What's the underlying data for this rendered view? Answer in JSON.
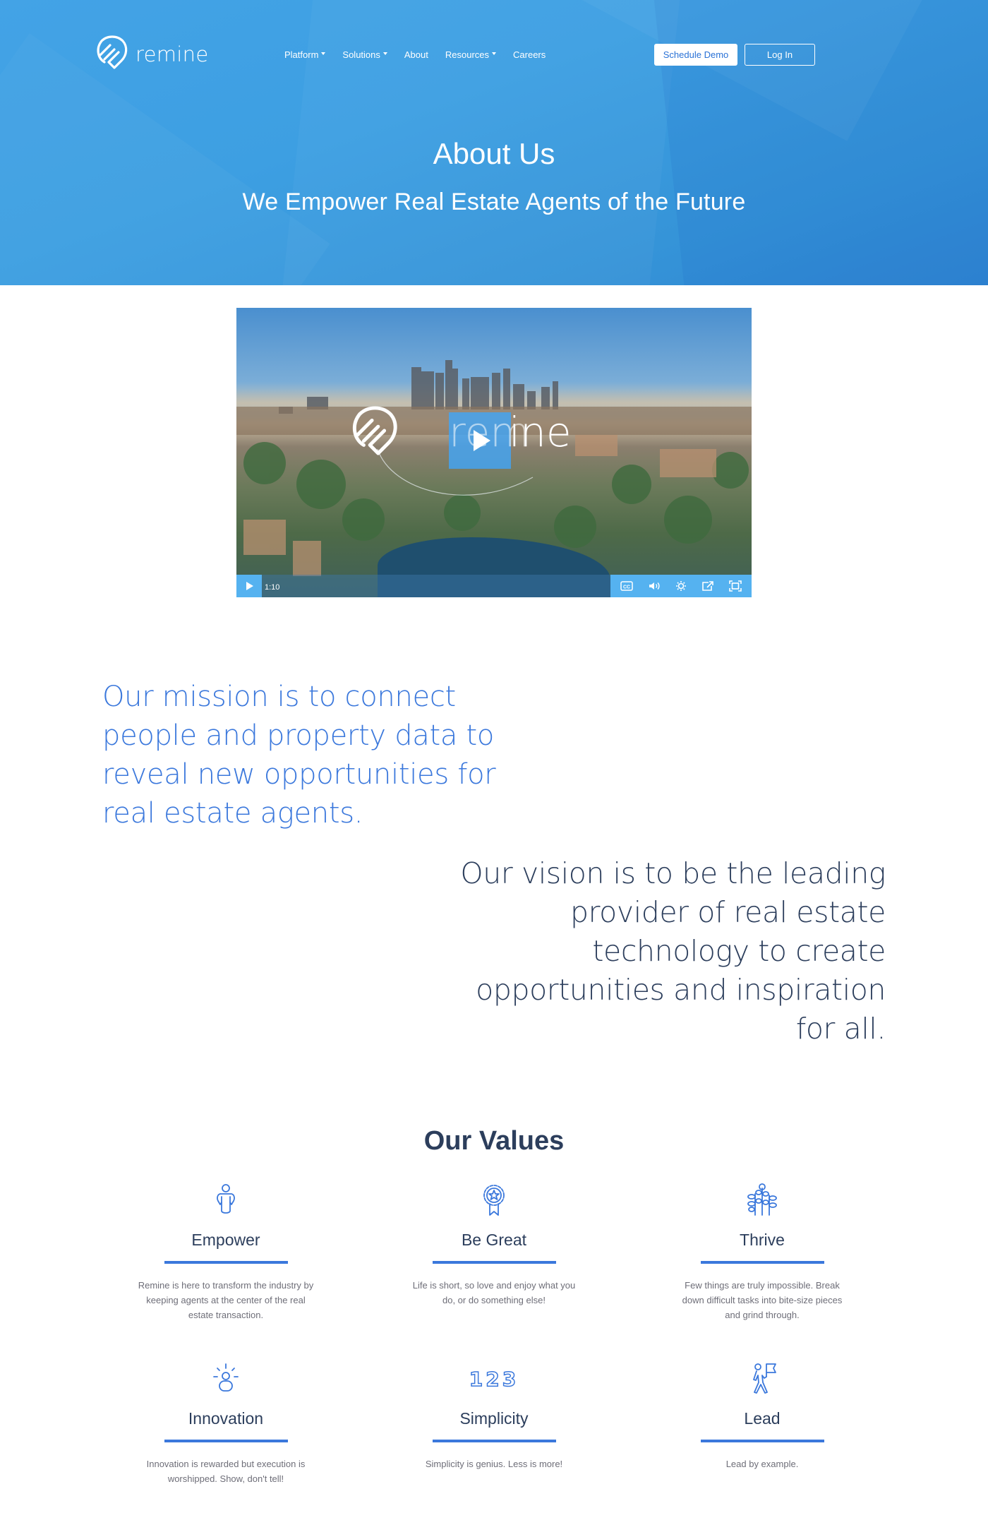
{
  "header": {
    "logo_text": "remine",
    "nav": [
      {
        "label": "Platform",
        "has_dropdown": true
      },
      {
        "label": "Solutions",
        "has_dropdown": true
      },
      {
        "label": "About",
        "has_dropdown": false
      },
      {
        "label": "Resources",
        "has_dropdown": true
      },
      {
        "label": "Careers",
        "has_dropdown": false
      }
    ],
    "schedule_demo_label": "Schedule Demo",
    "login_label": "Log In"
  },
  "hero": {
    "title": "About Us",
    "subtitle": "We Empower Real Estate Agents of the Future"
  },
  "video": {
    "brand_overlay_dim": "rem",
    "brand_overlay_bright": "ine",
    "duration": "1:10",
    "controls": [
      "play-icon",
      "closed-captions-icon",
      "volume-icon",
      "settings-icon",
      "share-icon",
      "fullscreen-icon"
    ]
  },
  "mission": {
    "text": "Our mission is to connect people and property data to reveal new opportunities for real estate agents."
  },
  "vision": {
    "text": "Our vision is to be the leading provider of real estate technology to create opportunities and inspiration for all."
  },
  "values": {
    "title": "Our Values",
    "items": [
      {
        "icon": "person-hands-on-hips-icon",
        "title": "Empower",
        "description": "Remine is here to transform the industry by keeping agents at the center of the real estate transaction."
      },
      {
        "icon": "award-ribbon-icon",
        "title": "Be Great",
        "description": "Life is short, so love and enjoy what you do, or do something else!"
      },
      {
        "icon": "growing-plants-icon",
        "title": "Thrive",
        "description": "Few things are truly impossible. Break down difficult tasks into bite-size pieces and grind through."
      },
      {
        "icon": "idea-person-icon",
        "title": "Innovation",
        "description": "Innovation is rewarded but execution is worshipped. Show, don't tell!"
      },
      {
        "icon": "numbers-123-icon",
        "icon_text": "123",
        "title": "Simplicity",
        "description": "Simplicity is genius. Less is more!"
      },
      {
        "icon": "person-with-flag-icon",
        "title": "Lead",
        "description": "Lead by example."
      }
    ]
  },
  "colors": {
    "brand_blue": "#3b78dc",
    "hero_blue": "#3d9fe2",
    "heading_navy": "#2c3e5c",
    "body_gray": "#6e6e78"
  }
}
